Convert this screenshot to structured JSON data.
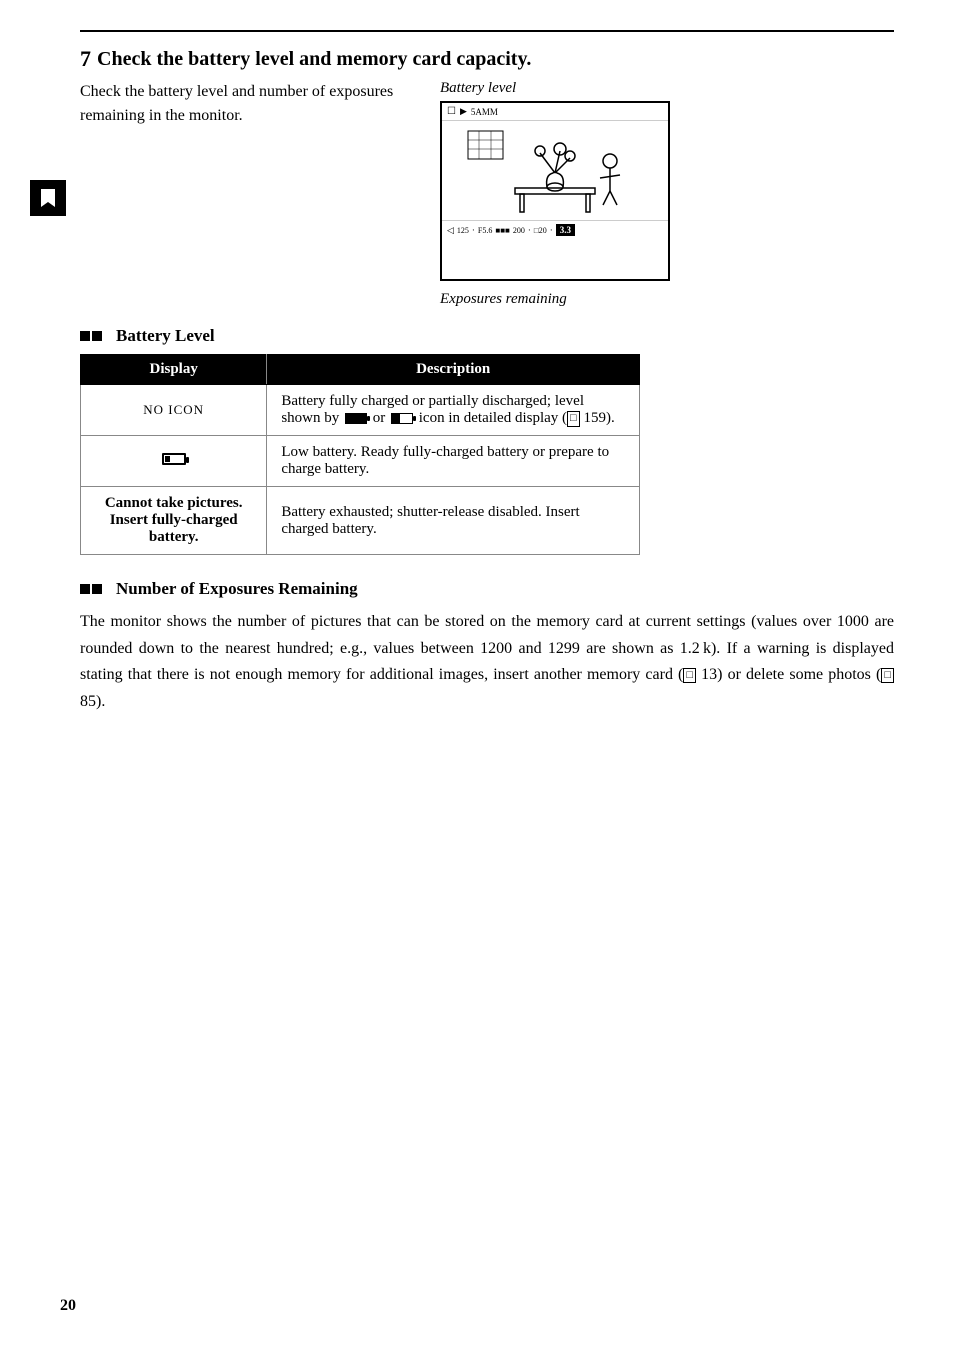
{
  "page": {
    "number": "20",
    "top_border": true
  },
  "step": {
    "number": "7",
    "title": "Check the battery level and memory card capacity.",
    "body": "Check the battery level and number of exposures remaining in the monitor."
  },
  "battery_diagram": {
    "label": "Battery level",
    "exposures_label": "Exposures remaining"
  },
  "battery_level_section": {
    "title": "Battery Level",
    "table": {
      "col1_header": "Display",
      "col2_header": "Description",
      "rows": [
        {
          "display": "NO ICON",
          "description": "Battery fully charged or partially discharged; level shown by  or  icon in detailed display ( 159)."
        },
        {
          "display": "battery-low-icon",
          "description": "Low battery. Ready fully-charged battery or prepare to charge battery."
        },
        {
          "display": "Cannot take pictures.\nInsert fully-charged\nbattery.",
          "description": "Battery exhausted; shutter-release disabled. Insert charged battery."
        }
      ]
    }
  },
  "exposures_section": {
    "title": "Number of Exposures Remaining",
    "body": "The monitor shows the number of pictures that can be stored on the memory card at current settings (values over 1000 are rounded down to the nearest hundred; e.g., values between 1200 and 1299 are shown as 1.2 k).  If a warning is displayed stating that there is not enough memory for additional images, insert another memory card (  13) or delete some photos (  85)."
  },
  "bookmark": {
    "icon": "bookmark"
  }
}
